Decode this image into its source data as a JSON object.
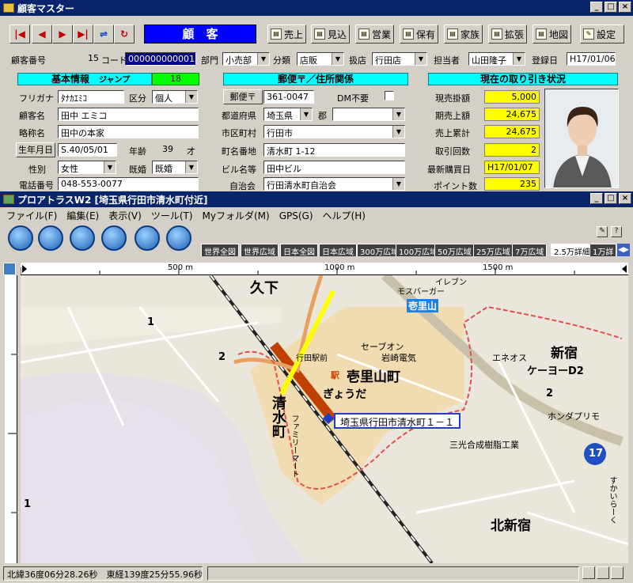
{
  "win1": {
    "title": "顧客マスター"
  },
  "toolbar": {
    "mode": "顧　客",
    "buttons": [
      "売上",
      "見込",
      "営業",
      "保有",
      "家族",
      "拡張",
      "地図",
      "設定"
    ]
  },
  "record": {
    "cust_no_label": "顧客番号",
    "cust_no": "15",
    "code_label": "コード",
    "code": "0000000000015",
    "dept_label": "部門",
    "dept": "小売部",
    "class_label": "分類",
    "class": "店販",
    "store_label": "扱店",
    "store": "行田店",
    "staff_label": "担当者",
    "staff": "山田隆子",
    "reg_label": "登録日",
    "reg_date": "H17/01/06"
  },
  "basic": {
    "header": "基本情報",
    "jump_label": "ジャンプ",
    "jump": "18",
    "furigana_label": "フリガナ",
    "furigana": "ﾀﾅｶｴﾐｺ",
    "kubun_label": "区分",
    "kubun": "個人",
    "name_label": "顧客名",
    "name": "田中 エミコ",
    "short_label": "略称名",
    "short": "田中の本家",
    "birth_label": "生年月日",
    "birth": "S.40/05/01",
    "age_label": "年齢",
    "age": "39",
    "age_unit": "才",
    "sex_label": "性別",
    "sex": "女性",
    "married_label": "既婚",
    "married": "既婚",
    "tel_label": "電話番号",
    "tel": "048-553-0077"
  },
  "address": {
    "header": "郵便〒／住所関係",
    "zip_label": "郵便〒",
    "zip": "361-0047",
    "dm_label": "DM不要",
    "pref_label": "都道府県",
    "pref": "埼玉県",
    "gun_label": "郡",
    "city_label": "市区町村",
    "city": "行田市",
    "town_label": "町名番地",
    "town": "清水町 1-12",
    "bldg_label": "ビル名等",
    "bldg": "田中ビル",
    "assoc_label": "自治会",
    "assoc": "行田清水町自治会"
  },
  "status": {
    "header": "現在の取り引き状況",
    "rows": [
      {
        "label": "現売掛額",
        "value": "5,000"
      },
      {
        "label": "期売上額",
        "value": "24,675"
      },
      {
        "label": "売上累計",
        "value": "24,675"
      },
      {
        "label": "取引回数",
        "value": "2"
      },
      {
        "label": "最新購買日",
        "value": "H17/01/07"
      },
      {
        "label": "ポイント数",
        "value": "235"
      }
    ]
  },
  "win2": {
    "title": "プロアトラスW2 [埼玉県行田市清水町付近]"
  },
  "menu": [
    "ファイル(F)",
    "編集(E)",
    "表示(V)",
    "ツール(T)",
    "Myフォルダ(M)",
    "GPS(G)",
    "ヘルプ(H)"
  ],
  "scales": [
    "世界全図",
    "世界広域",
    "日本全図",
    "日本広域",
    "300万広域",
    "100万広域",
    "50万広域",
    "25万広域",
    "7万広域",
    "2.5万詳細",
    "1万詳"
  ],
  "ruler": [
    "500 m",
    "1000 m",
    "1500 m"
  ],
  "map": {
    "labels": [
      "久下",
      "1",
      "2",
      "清水町",
      "ファミリーマート",
      "行田駅前",
      "駅",
      "壱里山町",
      "ぎょうだ",
      "セーブオン",
      "岩崎電気",
      "壱里山",
      "モスバーガー",
      "イレブン",
      "エネオス",
      "新宿",
      "ケーヨーD2",
      "2",
      "ホンダプリモ",
      "三光合成樹脂工業",
      "17",
      "すかいらーく",
      "北新宿",
      "1"
    ],
    "callout": "埼玉県行田市清水町１－１"
  },
  "statusbar": {
    "coords": "北緯36度06分28.26秒　東経139度25分55.96秒"
  }
}
